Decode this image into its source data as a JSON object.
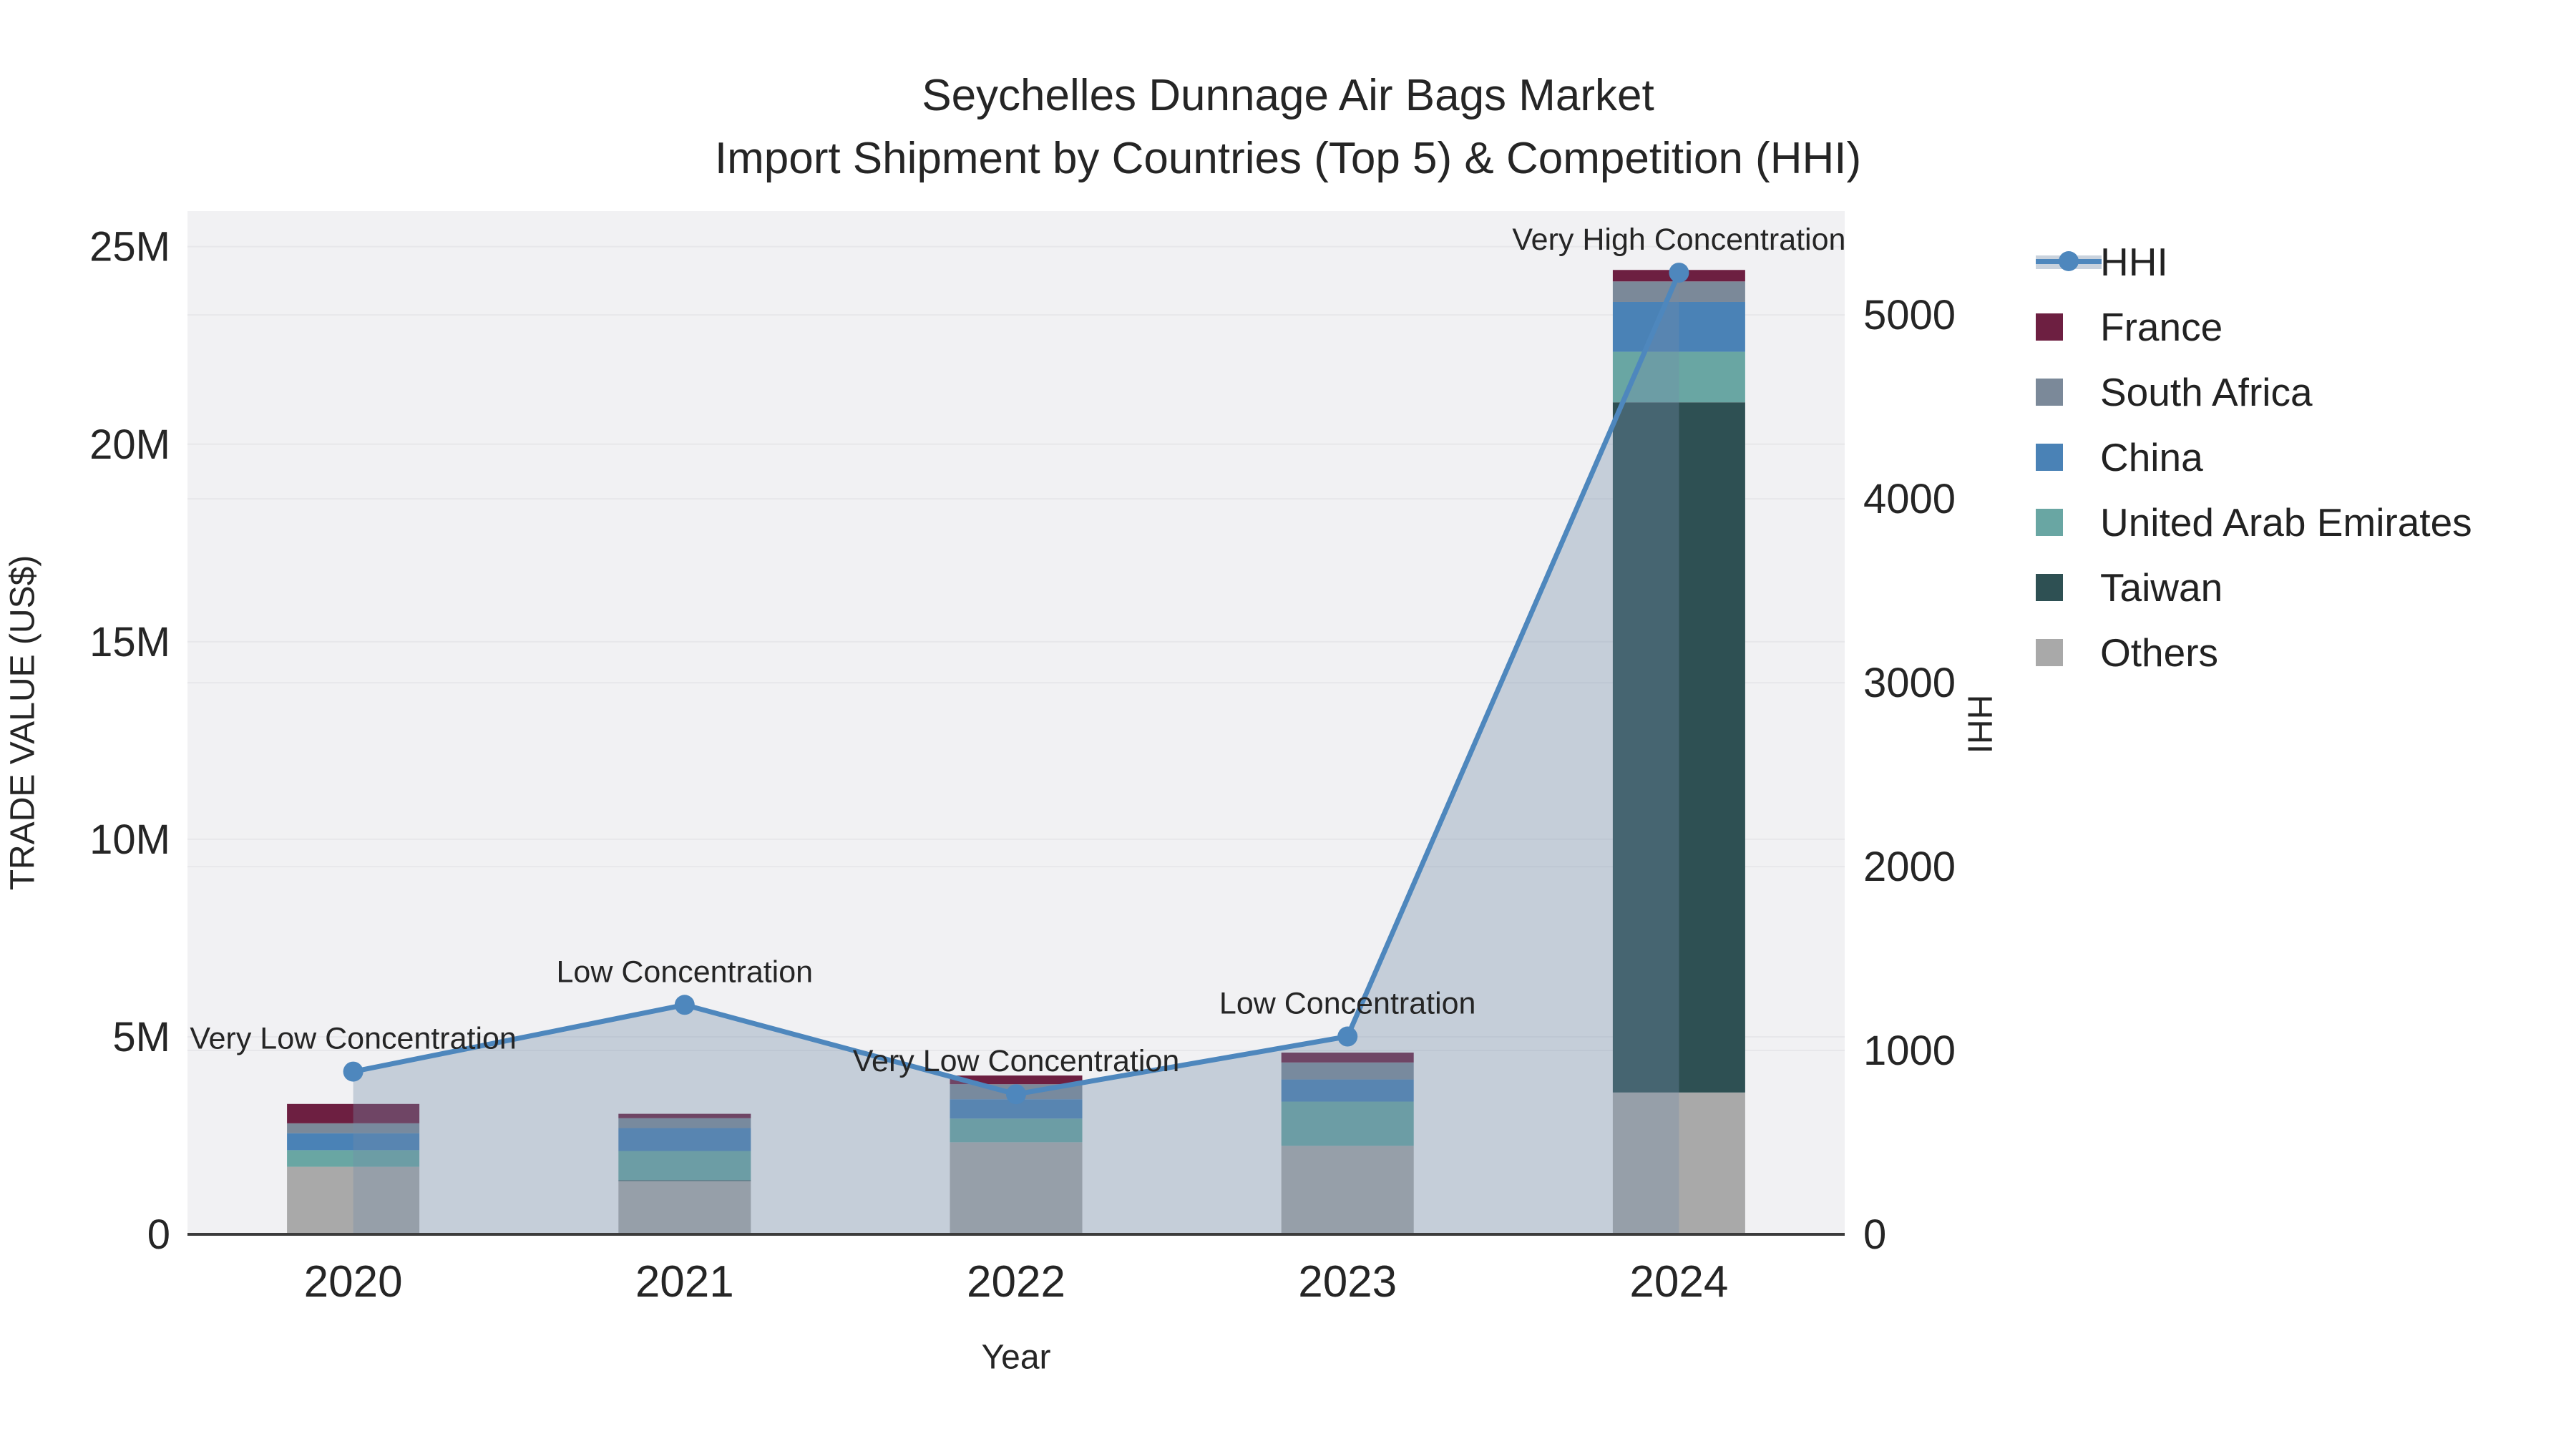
{
  "title": {
    "line1": "Seychelles Dunnage Air Bags Market",
    "line2": "Import Shipment by Countries (Top 5) & Competition (HHI)"
  },
  "axes": {
    "x_title": "Year",
    "y_left_title": "TRADE VALUE (US$)",
    "y_right_title": "HHI"
  },
  "chart_data": {
    "type": "bar+line",
    "categories": [
      "2020",
      "2021",
      "2022",
      "2023",
      "2024"
    ],
    "bar_unit": "millions USD",
    "bar_series": [
      {
        "name": "Others",
        "color": "#a9a9a9",
        "values": [
          1.71,
          1.35,
          2.33,
          2.24,
          3.59
        ]
      },
      {
        "name": "Taiwan",
        "color": "#2e5053",
        "values": [
          0,
          0.02,
          0,
          0,
          17.47
        ]
      },
      {
        "name": "United Arab Emirates",
        "color": "#69a6a3",
        "values": [
          0.42,
          0.74,
          0.6,
          1.12,
          1.28
        ]
      },
      {
        "name": "China",
        "color": "#4a82b6",
        "values": [
          0.43,
          0.58,
          0.49,
          0.56,
          1.26
        ]
      },
      {
        "name": "South Africa",
        "color": "#7b8999",
        "values": [
          0.25,
          0.25,
          0.38,
          0.43,
          0.52
        ]
      },
      {
        "name": "France",
        "color": "#6d1f41",
        "values": [
          0.49,
          0.11,
          0.22,
          0.25,
          0.29
        ]
      }
    ],
    "line_series": {
      "name": "HHI",
      "color": "#4e87bd",
      "fill_color": "rgba(116,139,170,0.35)",
      "values": [
        885,
        1248,
        762,
        1076,
        5230
      ]
    },
    "annotations": [
      "Very Low Concentration",
      "Low Concentration",
      "Very Low Concentration",
      "Low Concentration",
      "Very High Concentration"
    ],
    "y_left": {
      "ticks": [
        "0",
        "5M",
        "10M",
        "15M",
        "20M",
        "25M"
      ],
      "tick_values": [
        0,
        5,
        10,
        15,
        20,
        25
      ],
      "axis_max": 25.9
    },
    "y_right": {
      "ticks": [
        "0",
        "1000",
        "2000",
        "3000",
        "4000",
        "5000"
      ],
      "tick_values": [
        0,
        1000,
        2000,
        3000,
        4000,
        5000
      ],
      "axis_max": 5565
    },
    "legend_order": [
      "HHI",
      "France",
      "South Africa",
      "China",
      "United Arab Emirates",
      "Taiwan",
      "Others"
    ],
    "legend_position": "right",
    "grid": true,
    "plot_bg": "#f1f1f3",
    "grid_color": "#e7e7ea",
    "axisline_color": "#3c3c3c",
    "text_color": "#252525",
    "annotation_fontsize": 43,
    "tick_fontsize": 58
  }
}
